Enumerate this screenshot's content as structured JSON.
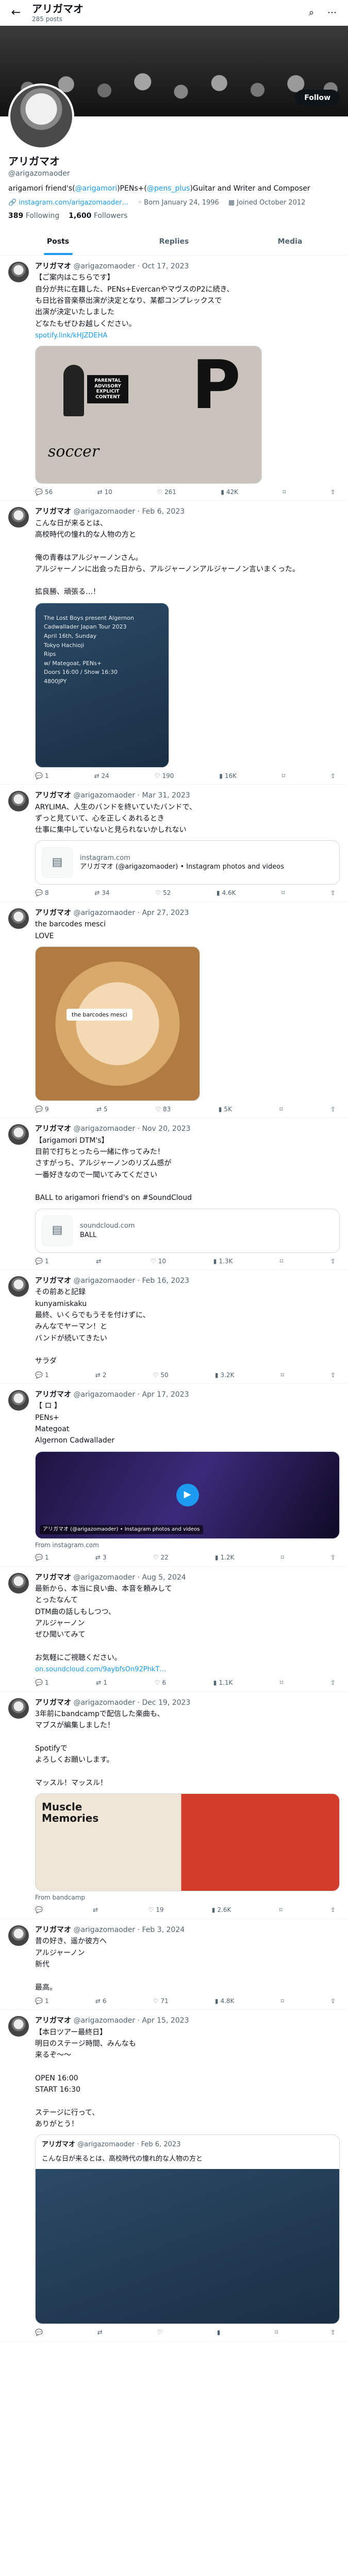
{
  "header": {
    "name": "アリガマオ",
    "posts": "285 posts"
  },
  "profile": {
    "name": "アリガマオ",
    "handle": "@arigazomaoder",
    "follow": "Follow",
    "bio_1": "arigamori friend's(",
    "bio_mention_1": "@arigamori",
    "bio_2": ")PENs+(",
    "bio_mention_2": "@pens_plus",
    "bio_3": ")Guitar and Writer and Composer",
    "link": "instagram.com/arigazomaoder…",
    "born": "Born January 24, 1996",
    "joined": "Joined October 2012",
    "following_count": "389",
    "following_label": "Following",
    "followers_count": "1,600",
    "followers_label": "Followers"
  },
  "tabs": [
    {
      "label": "Posts"
    },
    {
      "label": "Replies"
    },
    {
      "label": "Media"
    }
  ],
  "tweets": [
    {
      "name": "アリガマオ",
      "handle": "@arigazomaoder",
      "date": "· Oct 17, 2023",
      "lines": [
        "【ご案内はこちらです】",
        "自分が共に在籍した、PENs+EvercanやマヴスのP2に続き、",
        "も日比谷音楽祭出演が決定となり、某都コンプレックスで",
        "出演が決定いたしました",
        "どなたもぜひお越しください。"
      ],
      "link": "spotify.link/kHJZDEHA",
      "album_title": "PARENTAL ADVISORY EXPLICIT CONTENT",
      "album_word": "soccer",
      "album_letter": "P",
      "stats": {
        "reply": "56",
        "retweet": "10",
        "like": "261",
        "views": "42K"
      }
    },
    {
      "name": "アリガマオ",
      "handle": "@arigazomaoder",
      "date": "· Feb 6, 2023",
      "lines": [
        "こんな日が来るとは、",
        "高校時代の憧れ的な人物の方と",
        "",
        "俺の青春はアルジャーノンさん。",
        "アルジャーノンに出会った日から、アルジャーノンアルジャーノン言いまくった。",
        "",
        "拡良勝、頑張る…！"
      ],
      "poster": {
        "l1": "The Lost Boys present Algernon",
        "l2": "Cadwallader Japan Tour 2023",
        "l3": "April 16th, Sunday",
        "l4": "Tokyo Hachioji",
        "l5": "Rips",
        "l6": "w/ Mategoat, PENs+",
        "l7": "Doors 16:00 / Show 16:30",
        "l8": "4800JPY"
      },
      "stats": {
        "reply": "1",
        "retweet": "24",
        "like": "190",
        "views": "16K"
      }
    },
    {
      "name": "アリガマオ",
      "handle": "@arigazomaoder",
      "date": "· Mar 31, 2023",
      "lines": [
        "ARYLIMA、人生のバンドを終いていたバンドで、",
        "ずっと見ていて、心を正しくあれるとき",
        "仕事に集中していないと見られないかしれない"
      ],
      "card_title": "instagram.com",
      "card_sub": "アリガマオ (@arigazomaoder) • Instagram photos and videos",
      "stats": {
        "reply": "8",
        "retweet": "34",
        "like": "52",
        "views": "4.6K"
      }
    },
    {
      "name": "アリガマオ",
      "handle": "@arigazomaoder",
      "date": "· Apr 27, 2023",
      "lines": [
        "the barcodes mesci",
        "LOVE"
      ],
      "sticker": "the barcodes mesci",
      "stats": {
        "reply": "9",
        "retweet": "5",
        "like": "83",
        "views": "5K"
      }
    },
    {
      "name": "アリガマオ",
      "handle": "@arigazomaoder",
      "date": "· Nov 20, 2023",
      "lines": [
        "【arigamori DTM's】",
        "目前で打ちとったら一緒に作ってみた！",
        "さすがっち、アルジャーノンのリズム感が",
        "一番好きなので一聞いてみてください",
        "",
        "BALL to arigamori friend's on #SoundCloud"
      ],
      "card_title": "soundcloud.com",
      "card_sub": "BALL",
      "stats": {
        "reply": "1",
        "retweet": "",
        "like": "10",
        "views": "1.3K"
      }
    },
    {
      "name": "アリガマオ",
      "handle": "@arigazomaoder",
      "date": "· Feb 16, 2023",
      "lines": [
        "その前あと記録",
        "kunyamiskaku",
        "最終、いくらでもうそを付けずに、",
        "みんなでヤーマン！と",
        "バンドが続いてきたい",
        "",
        "サラダ"
      ],
      "stats": {
        "reply": "1",
        "retweet": "2",
        "like": "50",
        "views": "3.2K"
      }
    },
    {
      "name": "アリガマオ",
      "handle": "@arigazomaoder",
      "date": "· Apr 17, 2023",
      "lines": [
        "【 ロ 】",
        "PENs+",
        "Mategoat",
        "Algernon Cadwallader"
      ],
      "caption": "アリガマオ (@arigazomaoder) • Instagram photos and videos",
      "from": "From instagram.com",
      "stats": {
        "reply": "1",
        "retweet": "3",
        "like": "22",
        "views": "1.2K"
      }
    },
    {
      "name": "アリガマオ",
      "handle": "@arigazomaoder",
      "date": "· Aug 5, 2024",
      "lines": [
        "最新から、本当に良い曲、本音を頼みして",
        "とったなんて",
        "DTM曲の話しもしつつ、",
        "アルジャーノン",
        "ぜひ聞いてみて",
        "",
        "お気軽にご視聴ください。"
      ],
      "link": "on.soundcloud.com/9aybfsOn92PhkT…",
      "stats": {
        "reply": "1",
        "retweet": "1",
        "like": "6",
        "views": "1.1K"
      }
    },
    {
      "name": "アリガマオ",
      "handle": "@arigazomaoder",
      "date": "· Dec 19, 2023",
      "lines": [
        "3年前にbandcampで配信した楽曲も、",
        "マブスが編集しました！",
        "",
        "Spotifyで",
        "よろしくお願いします。",
        "",
        "マッスル！マッスル！"
      ],
      "album_title": "Muscle Memories",
      "from": "From bandcamp",
      "stats": {
        "reply": "",
        "retweet": "",
        "like": "19",
        "views": "2.6K"
      }
    },
    {
      "name": "アリガマオ",
      "handle": "@arigazomaoder",
      "date": "· Feb 3, 2024",
      "lines": [
        "昔の好き、遥か彼方へ",
        "アルジャーノン",
        "新代",
        "",
        "最高。"
      ],
      "stats": {
        "reply": "1",
        "retweet": "6",
        "like": "71",
        "views": "4.8K"
      }
    },
    {
      "name": "アリガマオ",
      "handle": "@arigazomaoder",
      "date": "· Apr 15, 2023",
      "lines": [
        "【本日ツアー最終日】",
        "明日のステージ時間、みんなも",
        "来るぞ〜〜",
        "",
        "OPEN 16:00",
        "START 16:30",
        "",
        "ステージに行って、",
        "ありがとう！"
      ],
      "quote_name": "アリガマオ",
      "quote_handle": "@arigazomaoder · Feb 6, 2023",
      "quote_text": "こんな日が来るとは、高校時代の憧れ的な人物の方と",
      "stats": {
        "reply": "",
        "retweet": "",
        "like": "",
        "views": ""
      }
    }
  ]
}
